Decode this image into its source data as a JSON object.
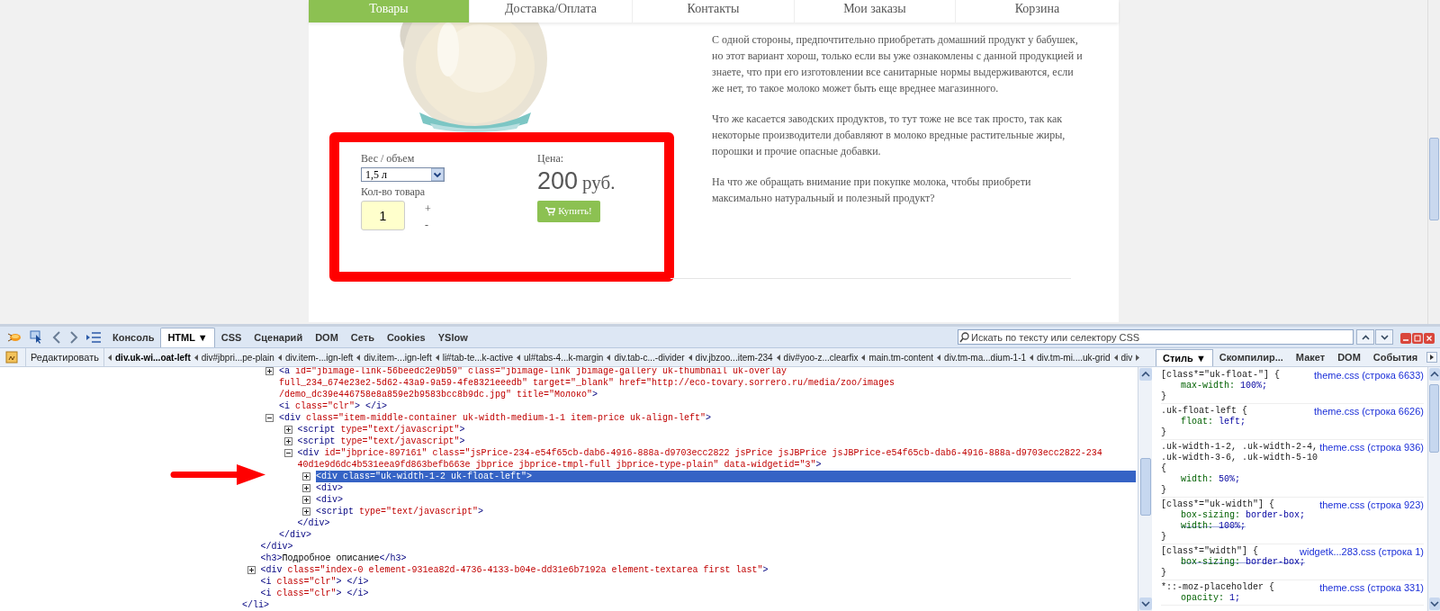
{
  "site_nav": [
    {
      "label": "Товары",
      "selected": true
    },
    {
      "label": "Доставка/Оплата",
      "selected": false
    },
    {
      "label": "Контакты",
      "selected": false
    },
    {
      "label": "Мои заказы",
      "selected": false
    },
    {
      "label": "Корзина",
      "selected": false
    }
  ],
  "product": {
    "weight_label": "Вес / объем",
    "weight_value": "1,5 л",
    "quantity_label": "Кол-во товара",
    "quantity": "1",
    "plus": "+",
    "minus": "-",
    "price_label": "Цена:",
    "price": "200",
    "currency": "руб.",
    "buy_button": "Купить!"
  },
  "description": [
    {
      "lines": [
        "С одной стороны, предпочтительно приобретать домашний продукт у бабушек,",
        "но этот вариант хорош, только если вы уже ознакомлены с данной продукцией и",
        "знаете, что при его изготовлении все санитарные нормы выдерживаются, если",
        "же нет, то такое молоко может быть еще вреднее магазинного."
      ]
    },
    {
      "lines": [
        "Что же касается заводских продуктов, то тут тоже не все так просто, так как",
        "некоторые производители добавляют в молоко вредные растительные жиры,",
        "порошки и прочие опасные добавки."
      ]
    },
    {
      "lines": [
        "На что же обращать внимание при покупке молока, чтобы приобрети",
        "максимально натуральный и полезный продукт?"
      ]
    }
  ],
  "devtools": {
    "toolbar_tabs": [
      {
        "label": "Консоль",
        "selected": false
      },
      {
        "label": "HTML ▼",
        "selected": true
      },
      {
        "label": "CSS",
        "selected": false
      },
      {
        "label": "Сценарий",
        "selected": false
      },
      {
        "label": "DOM",
        "selected": false
      },
      {
        "label": "Сеть",
        "selected": false
      },
      {
        "label": "Cookies",
        "selected": false
      },
      {
        "label": "YSlow",
        "selected": false
      }
    ],
    "search": {
      "placeholder": "Искать по тексту или селектору CSS"
    },
    "edit_button": "Редактировать",
    "breadcrumbs": [
      {
        "label": "div.uk-wi...oat-left",
        "selected": true
      },
      {
        "label": "div#jbpri...pe-plain",
        "selected": false
      },
      {
        "label": "div.item-...ign-left",
        "selected": false
      },
      {
        "label": "div.item-...ign-left",
        "selected": false
      },
      {
        "label": "li#tab-te...k-active",
        "selected": false
      },
      {
        "label": "ul#tabs-4...k-margin",
        "selected": false
      },
      {
        "label": "div.tab-c...-divider",
        "selected": false
      },
      {
        "label": "div.jbzoo...item-234",
        "selected": false
      },
      {
        "label": "div#yoo-z...clearfix",
        "selected": false
      },
      {
        "label": "main.tm-content",
        "selected": false
      },
      {
        "label": "div.tm-ma...dium-1-1",
        "selected": false
      },
      {
        "label": "div.tm-mi....uk-grid",
        "selected": false
      },
      {
        "label": "div",
        "selected": false
      }
    ],
    "dom_tree": [
      {
        "kind": "group",
        "closing": "</li>",
        "children": [
          {
            "kind": "group",
            "closing": "</div>",
            "children": [
              {
                "kind": "collapsible",
                "expanded": false,
                "selected": false,
                "lines": [
                  "<a id=\"jbimage-link-56beedc2e9b59\" class=\"jbimage-link jbimage-gallery uk-thumbnail uk-overlay",
                  "full_234_674e23e2-5d62-43a9-9a59-4fe8321eeedb\" target=\"_blank\" href=\"http://eco-tovary.sorrero.ru/media/zoo/images",
                  "/demo_dc39e446758e8a859e2b9583bcc8b9dc.jpg\" title=\"Молоко\">"
                ]
              },
              {
                "kind": "leaf",
                "selected": false,
                "lines": [
                  "<i class=\"clr\"> </i>"
                ]
              },
              {
                "kind": "collapsible",
                "expanded": true,
                "selected": false,
                "lines": [
                  "<div class=\"item-middle-container uk-width-medium-1-1 item-price uk-align-left\">"
                ],
                "closing": "</div>",
                "children": [
                  {
                    "kind": "collapsible",
                    "expanded": false,
                    "selected": false,
                    "lines": [
                      "<script type=\"text/javascript\">"
                    ]
                  },
                  {
                    "kind": "collapsible",
                    "expanded": false,
                    "selected": false,
                    "lines": [
                      "<script type=\"text/javascript\">"
                    ]
                  },
                  {
                    "kind": "collapsible",
                    "expanded": true,
                    "selected": false,
                    "lines": [
                      "<div id=\"jbprice-897161\" class=\"jsPrice-234-e54f65cb-dab6-4916-888a-d9703ecc2822 jsPrice jsJBPrice jsJBPrice-e54f65cb-dab6-4916-888a-d9703ecc2822-234",
                      "40d1e9d6dc4b531eea9fd863befb663e jbprice jbprice-tmpl-full jbprice-type-plain\" data-widgetid=\"3\">"
                    ],
                    "closing": "</div>",
                    "children": [
                      {
                        "kind": "collapsible",
                        "expanded": false,
                        "selected": true,
                        "lines": [
                          "<div class=\"uk-width-1-2 uk-float-left\">"
                        ]
                      },
                      {
                        "kind": "collapsible",
                        "expanded": false,
                        "selected": false,
                        "lines": [
                          "<div>"
                        ]
                      },
                      {
                        "kind": "collapsible",
                        "expanded": false,
                        "selected": false,
                        "lines": [
                          "<div>"
                        ]
                      },
                      {
                        "kind": "collapsible",
                        "expanded": false,
                        "selected": false,
                        "lines": [
                          "<script type=\"text/javascript\">"
                        ]
                      }
                    ]
                  }
                ]
              }
            ]
          },
          {
            "kind": "leaf",
            "selected": false,
            "lines": [
              "<h3>Подробное описание</h3>"
            ]
          },
          {
            "kind": "collapsible",
            "expanded": false,
            "selected": false,
            "lines": [
              "<div class=\"index-0 element-931ea82d-4736-4133-b04e-dd31e6b7192a element-textarea first last\">"
            ]
          },
          {
            "kind": "leaf",
            "selected": false,
            "lines": [
              "<i class=\"clr\"> </i>"
            ]
          },
          {
            "kind": "leaf",
            "selected": false,
            "lines": [
              "<i class=\"clr\"> </i>"
            ]
          }
        ]
      }
    ],
    "side_tabs": [
      {
        "label": "Стиль ▼",
        "selected": true
      },
      {
        "label": "Скомпилир...",
        "selected": false
      },
      {
        "label": "Макет",
        "selected": false
      },
      {
        "label": "DOM",
        "selected": false
      },
      {
        "label": "События",
        "selected": false
      }
    ],
    "css_rules": [
      {
        "selector": [
          "[class*=\"uk-float-\"] {"
        ],
        "source": "theme.css (строка 6633)",
        "properties": [
          {
            "name": "max-width:",
            "value": "100%;",
            "overridden": false
          }
        ],
        "close": "}"
      },
      {
        "selector": [
          ".uk-float-left {"
        ],
        "source": "theme.css (строка 6626)",
        "properties": [
          {
            "name": "float:",
            "value": "left;",
            "overridden": false
          }
        ],
        "close": "}"
      },
      {
        "selector": [
          ".uk-width-1-2, .uk-width-2-4,",
          ".uk-width-3-6, .uk-width-5-10",
          "{"
        ],
        "source": "theme.css (строка 936)",
        "properties": [
          {
            "name": "width:",
            "value": "50%;",
            "overridden": false
          }
        ],
        "close": "}"
      },
      {
        "selector": [
          "[class*=\"uk-width\"] {"
        ],
        "source": "theme.css (строка 923)",
        "properties": [
          {
            "name": "box-sizing:",
            "value": "border-box;",
            "overridden": false
          },
          {
            "name": "width:",
            "value": "100%;",
            "overridden": true
          }
        ],
        "close": "}"
      },
      {
        "selector": [
          "[class*=\"width\"] {"
        ],
        "source": "widgetk...283.css (строка 1)",
        "properties": [
          {
            "name": "box-sizing:",
            "value": "border-box;",
            "overridden": true
          }
        ],
        "close": "}"
      },
      {
        "selector": [
          "*::-moz-placeholder {"
        ],
        "source": "theme.css (строка 331)",
        "properties": [
          {
            "name": "opacity:",
            "value": "1;",
            "overridden": false
          }
        ]
      }
    ]
  }
}
